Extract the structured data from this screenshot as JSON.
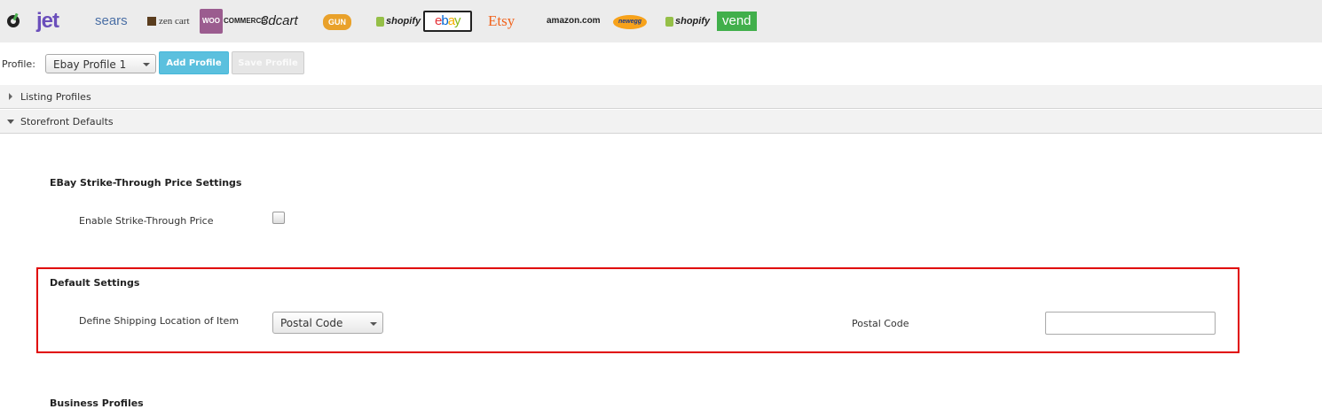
{
  "channels": [
    {
      "name": "bigcommerce-icon",
      "label": ""
    },
    {
      "name": "jet-logo",
      "label": "jet"
    },
    {
      "name": "sears-logo",
      "label": "sears"
    },
    {
      "name": "zencart-logo",
      "label": "zen cart"
    },
    {
      "name": "woocommerce-logo",
      "label_a": "WOO",
      "label_b": "COMMERCE"
    },
    {
      "name": "3dcart-logo",
      "label": "3dcart"
    },
    {
      "name": "gunbroker-logo",
      "label": "GUN"
    },
    {
      "name": "shopify-logo",
      "label": "shopify"
    },
    {
      "name": "ebay-logo",
      "label_e": "e",
      "label_b": "b",
      "label_a": "a",
      "label_y": "y",
      "active": true
    },
    {
      "name": "etsy-logo",
      "label": "Etsy"
    },
    {
      "name": "amazon-logo",
      "label": "amazon.com"
    },
    {
      "name": "newegg-logo",
      "label": "newegg"
    },
    {
      "name": "shopify-logo-2",
      "label": "shopify"
    },
    {
      "name": "vend-logo",
      "label": "vend"
    }
  ],
  "profile": {
    "label": "Profile:",
    "selected": "Ebay Profile 1",
    "add_button": "Add Profile",
    "save_button": "Save Profile"
  },
  "accordion": {
    "listing_profiles": "Listing Profiles",
    "storefront_defaults": "Storefront Defaults"
  },
  "strike_through": {
    "title": "EBay Strike-Through Price Settings",
    "enable_label": "Enable Strike-Through Price",
    "enabled": false
  },
  "default_settings": {
    "title": "Default Settings",
    "shipping_location_label": "Define Shipping Location of Item",
    "shipping_location_value": "Postal Code",
    "postal_code_label": "Postal Code",
    "postal_code_value": ""
  },
  "next_section": {
    "title": "Business Profiles"
  },
  "colors": {
    "highlight": "#e00000",
    "add_button": "#5bc0de",
    "logo_bar": "#ececec"
  }
}
